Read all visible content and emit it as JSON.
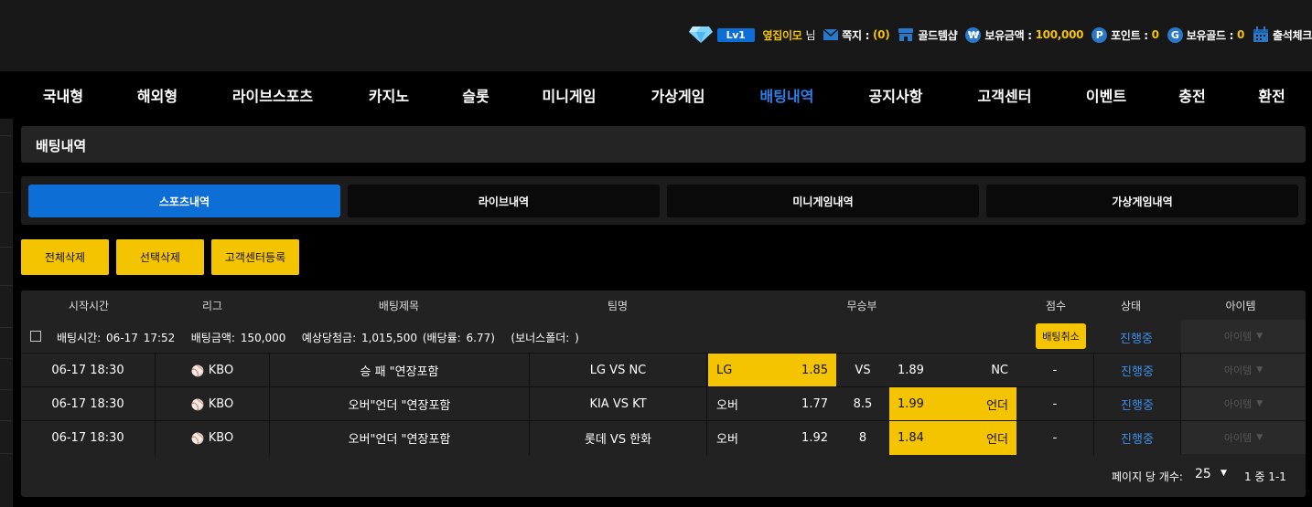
{
  "header": {
    "level": "Lv1",
    "nickname": "옆집이모",
    "honorific": "님",
    "message_label": "쪽지 :",
    "message_count": "(0)",
    "gold_shop": "골드템샵",
    "balance_label": "보유금액 :",
    "balance": "100,000",
    "point_label": "포인트 :",
    "point": "0",
    "gold_label": "보유골드 :",
    "gold": "0",
    "attendance": "출석체크"
  },
  "nav": [
    {
      "label": "국내형"
    },
    {
      "label": "해외형"
    },
    {
      "label": "라이브스포츠"
    },
    {
      "label": "카지노"
    },
    {
      "label": "슬롯"
    },
    {
      "label": "미니게임"
    },
    {
      "label": "가상게임"
    },
    {
      "label": "배팅내역"
    },
    {
      "label": "공지사항"
    },
    {
      "label": "고객센터"
    },
    {
      "label": "이벤트"
    },
    {
      "label": "충전"
    },
    {
      "label": "환전"
    }
  ],
  "page_title": "배팅내역",
  "tabs": [
    {
      "label": "스포츠내역"
    },
    {
      "label": "라이브내역"
    },
    {
      "label": "미니게임내역"
    },
    {
      "label": "가상게임내역"
    }
  ],
  "actions": {
    "delete_all": "전체삭제",
    "delete_selected": "선택삭제",
    "register_cs": "고객센터등록"
  },
  "table": {
    "headers": [
      "시작시간",
      "리그",
      "배팅제목",
      "팀명",
      "무승부",
      "점수",
      "상태",
      "아이템"
    ],
    "group": {
      "bet_time_label": "배팅시간:",
      "bet_time": "06-17 17:52",
      "bet_amount_label": "배팅금액:",
      "bet_amount": "150,000",
      "expected_label": "예상당첨금:",
      "expected": "1,015,500",
      "odds_text": "(배당률: 6.77)",
      "bonus_text": "(보너스폴더: )",
      "cancel_label": "배팅취소",
      "status": "진행중",
      "item": "아이템"
    },
    "rows": [
      {
        "time": "06-17 18:30",
        "league": "KBO",
        "title": "승 패 \"연장포함",
        "teams": "LG VS NC",
        "home_label": "LG",
        "home_odds": "1.85",
        "mid": "VS",
        "away_odds": "1.89",
        "away_label": "NC",
        "score": "-",
        "status": "진행중",
        "item": "아이템"
      },
      {
        "time": "06-17 18:30",
        "league": "KBO",
        "title": "오버\"언더 \"연장포함",
        "teams": "KIA VS KT",
        "home_label": "오버",
        "home_odds": "1.77",
        "mid": "8.5",
        "away_odds": "1.99",
        "away_label": "언더",
        "score": "-",
        "status": "진행중",
        "item": "아이템"
      },
      {
        "time": "06-17 18:30",
        "league": "KBO",
        "title": "오버\"언더 \"연장포함",
        "teams": "롯데 VS 한화",
        "home_label": "오버",
        "home_odds": "1.92",
        "mid": "8",
        "away_odds": "1.84",
        "away_label": "언더",
        "score": "-",
        "status": "진행중",
        "item": "아이템"
      }
    ]
  },
  "pagination": {
    "per_page_label": "페이지 당 개수:",
    "per_page": "25",
    "range": "1 중 1-1"
  },
  "colors": {
    "accent": "#0d6ed6",
    "highlight": "#f5c400",
    "status": "#3d8ee8"
  }
}
